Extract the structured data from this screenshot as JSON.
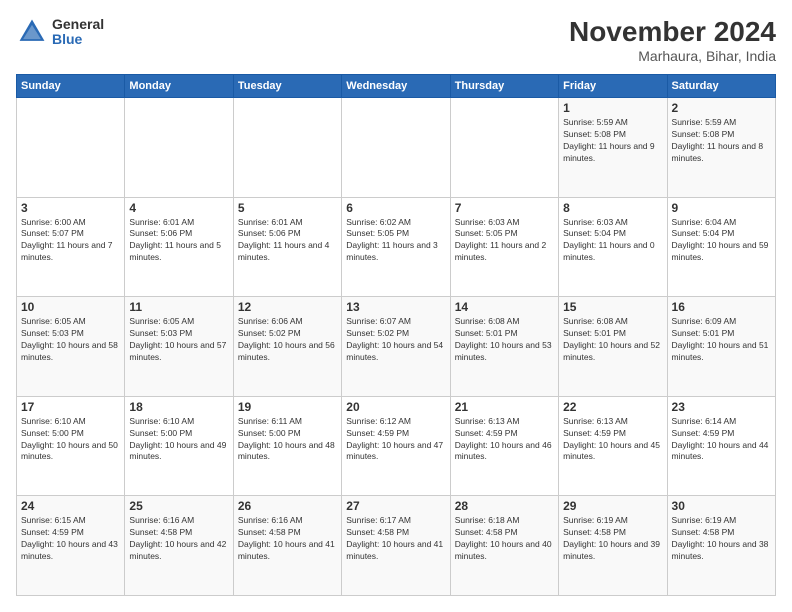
{
  "logo": {
    "general": "General",
    "blue": "Blue"
  },
  "header": {
    "month": "November 2024",
    "location": "Marhaura, Bihar, India"
  },
  "weekdays": [
    "Sunday",
    "Monday",
    "Tuesday",
    "Wednesday",
    "Thursday",
    "Friday",
    "Saturday"
  ],
  "weeks": [
    [
      {
        "day": "",
        "info": ""
      },
      {
        "day": "",
        "info": ""
      },
      {
        "day": "",
        "info": ""
      },
      {
        "day": "",
        "info": ""
      },
      {
        "day": "",
        "info": ""
      },
      {
        "day": "1",
        "info": "Sunrise: 5:59 AM\nSunset: 5:08 PM\nDaylight: 11 hours and 9 minutes."
      },
      {
        "day": "2",
        "info": "Sunrise: 5:59 AM\nSunset: 5:08 PM\nDaylight: 11 hours and 8 minutes."
      }
    ],
    [
      {
        "day": "3",
        "info": "Sunrise: 6:00 AM\nSunset: 5:07 PM\nDaylight: 11 hours and 7 minutes."
      },
      {
        "day": "4",
        "info": "Sunrise: 6:01 AM\nSunset: 5:06 PM\nDaylight: 11 hours and 5 minutes."
      },
      {
        "day": "5",
        "info": "Sunrise: 6:01 AM\nSunset: 5:06 PM\nDaylight: 11 hours and 4 minutes."
      },
      {
        "day": "6",
        "info": "Sunrise: 6:02 AM\nSunset: 5:05 PM\nDaylight: 11 hours and 3 minutes."
      },
      {
        "day": "7",
        "info": "Sunrise: 6:03 AM\nSunset: 5:05 PM\nDaylight: 11 hours and 2 minutes."
      },
      {
        "day": "8",
        "info": "Sunrise: 6:03 AM\nSunset: 5:04 PM\nDaylight: 11 hours and 0 minutes."
      },
      {
        "day": "9",
        "info": "Sunrise: 6:04 AM\nSunset: 5:04 PM\nDaylight: 10 hours and 59 minutes."
      }
    ],
    [
      {
        "day": "10",
        "info": "Sunrise: 6:05 AM\nSunset: 5:03 PM\nDaylight: 10 hours and 58 minutes."
      },
      {
        "day": "11",
        "info": "Sunrise: 6:05 AM\nSunset: 5:03 PM\nDaylight: 10 hours and 57 minutes."
      },
      {
        "day": "12",
        "info": "Sunrise: 6:06 AM\nSunset: 5:02 PM\nDaylight: 10 hours and 56 minutes."
      },
      {
        "day": "13",
        "info": "Sunrise: 6:07 AM\nSunset: 5:02 PM\nDaylight: 10 hours and 54 minutes."
      },
      {
        "day": "14",
        "info": "Sunrise: 6:08 AM\nSunset: 5:01 PM\nDaylight: 10 hours and 53 minutes."
      },
      {
        "day": "15",
        "info": "Sunrise: 6:08 AM\nSunset: 5:01 PM\nDaylight: 10 hours and 52 minutes."
      },
      {
        "day": "16",
        "info": "Sunrise: 6:09 AM\nSunset: 5:01 PM\nDaylight: 10 hours and 51 minutes."
      }
    ],
    [
      {
        "day": "17",
        "info": "Sunrise: 6:10 AM\nSunset: 5:00 PM\nDaylight: 10 hours and 50 minutes."
      },
      {
        "day": "18",
        "info": "Sunrise: 6:10 AM\nSunset: 5:00 PM\nDaylight: 10 hours and 49 minutes."
      },
      {
        "day": "19",
        "info": "Sunrise: 6:11 AM\nSunset: 5:00 PM\nDaylight: 10 hours and 48 minutes."
      },
      {
        "day": "20",
        "info": "Sunrise: 6:12 AM\nSunset: 4:59 PM\nDaylight: 10 hours and 47 minutes."
      },
      {
        "day": "21",
        "info": "Sunrise: 6:13 AM\nSunset: 4:59 PM\nDaylight: 10 hours and 46 minutes."
      },
      {
        "day": "22",
        "info": "Sunrise: 6:13 AM\nSunset: 4:59 PM\nDaylight: 10 hours and 45 minutes."
      },
      {
        "day": "23",
        "info": "Sunrise: 6:14 AM\nSunset: 4:59 PM\nDaylight: 10 hours and 44 minutes."
      }
    ],
    [
      {
        "day": "24",
        "info": "Sunrise: 6:15 AM\nSunset: 4:59 PM\nDaylight: 10 hours and 43 minutes."
      },
      {
        "day": "25",
        "info": "Sunrise: 6:16 AM\nSunset: 4:58 PM\nDaylight: 10 hours and 42 minutes."
      },
      {
        "day": "26",
        "info": "Sunrise: 6:16 AM\nSunset: 4:58 PM\nDaylight: 10 hours and 41 minutes."
      },
      {
        "day": "27",
        "info": "Sunrise: 6:17 AM\nSunset: 4:58 PM\nDaylight: 10 hours and 41 minutes."
      },
      {
        "day": "28",
        "info": "Sunrise: 6:18 AM\nSunset: 4:58 PM\nDaylight: 10 hours and 40 minutes."
      },
      {
        "day": "29",
        "info": "Sunrise: 6:19 AM\nSunset: 4:58 PM\nDaylight: 10 hours and 39 minutes."
      },
      {
        "day": "30",
        "info": "Sunrise: 6:19 AM\nSunset: 4:58 PM\nDaylight: 10 hours and 38 minutes."
      }
    ]
  ]
}
